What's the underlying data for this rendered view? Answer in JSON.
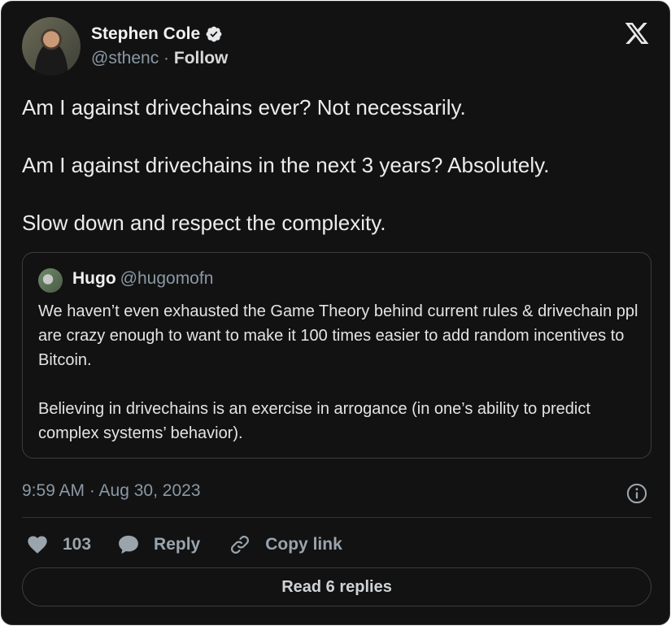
{
  "author": {
    "name": "Stephen Cole",
    "handle": "@sthenc",
    "separator": " · ",
    "follow_label": "Follow",
    "verified_icon": "verified-badge-icon"
  },
  "tweet": {
    "paragraphs": [
      "Am I against drivechains ever? Not necessarily.",
      "Am I against drivechains in the next 3 years? Absolutely.",
      "Slow down and respect the complexity."
    ],
    "timestamp": "9:59 AM · Aug 30, 2023"
  },
  "quoted_tweet": {
    "name": "Hugo",
    "handle": "@hugomofn",
    "paragraphs": [
      "We haven’t even exhausted the Game Theory behind current rules & drivechain ppl are crazy enough to want to make it 100 times easier to add random incentives to Bitcoin.",
      "Believing in drivechains is an exercise in arrogance (in one’s ability to predict complex systems’ behavior)."
    ]
  },
  "actions": {
    "like_count": "103",
    "reply_label": "Reply",
    "copy_link_label": "Copy link"
  },
  "read_replies_label": "Read 6 replies",
  "colors": {
    "background": "#121212",
    "border": "#2f3336",
    "muted_text": "#8b98a5"
  }
}
